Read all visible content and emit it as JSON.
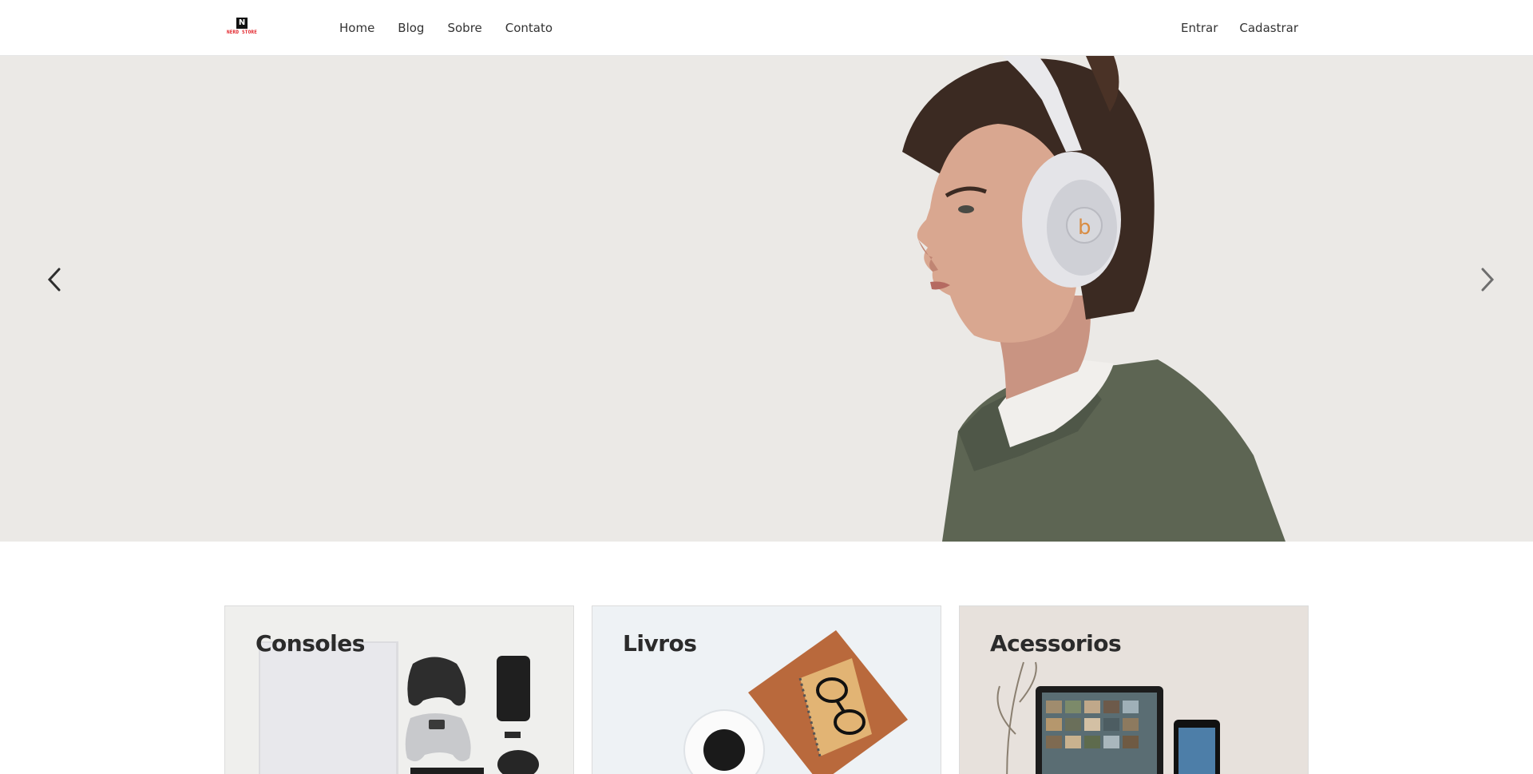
{
  "header": {
    "logo": {
      "badge": "N",
      "text": "NERD STORE"
    },
    "nav": [
      {
        "label": "Home"
      },
      {
        "label": "Blog"
      },
      {
        "label": "Sobre"
      },
      {
        "label": "Contato"
      }
    ],
    "auth": {
      "login": "Entrar",
      "register": "Cadastrar"
    }
  },
  "hero": {
    "background": "#ebe9e6",
    "icons": {
      "prev": "chevron-left-icon",
      "next": "chevron-right-icon"
    }
  },
  "categories": [
    {
      "title": "Consoles"
    },
    {
      "title": "Livros"
    },
    {
      "title": "Acessorios"
    }
  ],
  "colors": {
    "brand_red": "#e11b22",
    "text_dark": "#2b2b2b",
    "hero_bg": "#ebe9e6"
  }
}
